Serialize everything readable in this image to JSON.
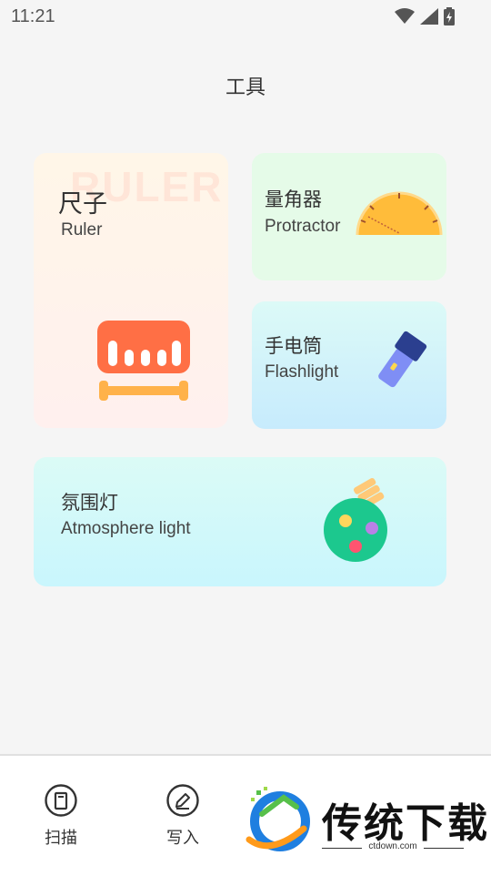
{
  "status": {
    "time": "11:21"
  },
  "page": {
    "title": "工具"
  },
  "cards": {
    "ruler": {
      "title_cn": "尺子",
      "title_en": "Ruler",
      "watermark": "RULER"
    },
    "protractor": {
      "title_cn": "量角器",
      "title_en": "Protractor"
    },
    "flashlight": {
      "title_cn": "手电筒",
      "title_en": "Flashlight"
    },
    "atmosphere": {
      "title_cn": "氛围灯",
      "title_en": "Atmosphere light"
    }
  },
  "tabs": [
    {
      "label": "扫描",
      "icon": "scan-icon"
    },
    {
      "label": "写入",
      "icon": "write-icon"
    }
  ],
  "brand": {
    "name": "传统下载",
    "url": "ctdown.com"
  },
  "colors": {
    "ruler_orange": "#ff6f45",
    "protractor_yellow": "#ffbc3a",
    "flash_blue": "#7f8ef5",
    "bulb_green": "#1cc88e"
  }
}
